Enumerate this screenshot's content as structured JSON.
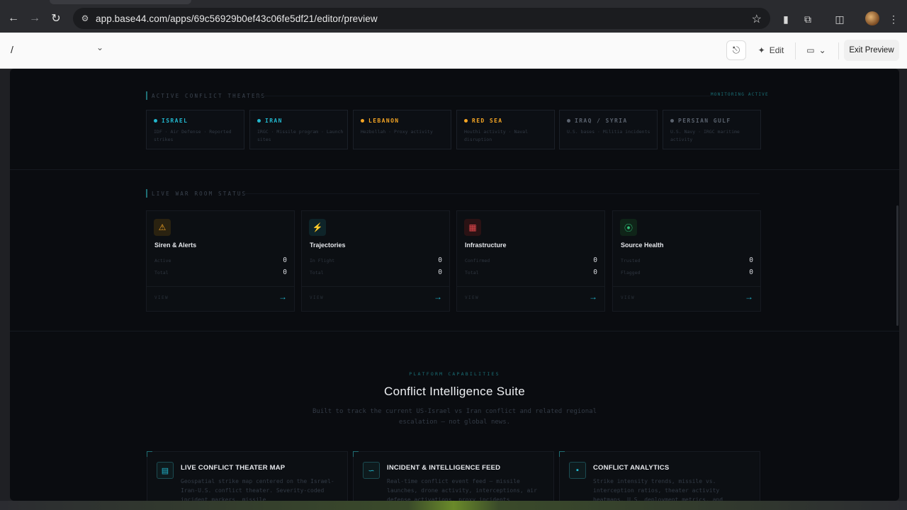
{
  "browser": {
    "url": "app.base44.com/apps/69c56929b0ef43c06fe5df21/editor/preview"
  },
  "editor": {
    "breadcrumb": "/",
    "edit_label": "Edit",
    "exit_label": "Exit Preview"
  },
  "theaters": {
    "label": "ACTIVE CONFLICT THEATERS",
    "status": "MONITORING ACTIVE",
    "items": [
      {
        "name": "ISRAEL",
        "desc": "IDF · Air Defense · Reported strikes",
        "color": "#22b8cf"
      },
      {
        "name": "IRAN",
        "desc": "IRGC · Missile program · Launch sites",
        "color": "#22b8cf"
      },
      {
        "name": "LEBANON",
        "desc": "Hezbollah · Proxy activity",
        "color": "#f5a524"
      },
      {
        "name": "RED SEA",
        "desc": "Houthi activity · Naval disruption",
        "color": "#f5a524"
      },
      {
        "name": "IRAQ / SYRIA",
        "desc": "U.S. bases · Militia incidents",
        "color": "#5a626e"
      },
      {
        "name": "PERSIAN GULF",
        "desc": "U.S. Navy · IRGC maritime activity",
        "color": "#5a626e"
      }
    ]
  },
  "war_room": {
    "label": "LIVE WAR ROOM STATUS",
    "cards": [
      {
        "title": "Siren & Alerts",
        "row1_label": "Active",
        "row1_value": "0",
        "row2_label": "Total",
        "row2_value": "0",
        "view": "VIEW"
      },
      {
        "title": "Trajectories",
        "row1_label": "In Flight",
        "row1_value": "0",
        "row2_label": "Total",
        "row2_value": "0",
        "view": "VIEW"
      },
      {
        "title": "Infrastructure",
        "row1_label": "Confirmed",
        "row1_value": "0",
        "row2_label": "Total",
        "row2_value": "0",
        "view": "VIEW"
      },
      {
        "title": "Source Health",
        "row1_label": "Trusted",
        "row1_value": "0",
        "row2_label": "Flagged",
        "row2_value": "0",
        "view": "VIEW"
      }
    ]
  },
  "capabilities": {
    "eyebrow": "PLATFORM CAPABILITIES",
    "title": "Conflict Intelligence Suite",
    "subtitle": "Built to track the current US-Israel vs Iran conflict and related regional escalation — not global news.",
    "features": [
      {
        "title": "LIVE CONFLICT THEATER MAP",
        "desc": "Geospatial strike map centered on the Israel-Iran-U.S. conflict theater. Severity-coded incident markers, missile"
      },
      {
        "title": "INCIDENT & INTELLIGENCE FEED",
        "desc": "Real-time conflict event feed — missile launches, drone activity, interceptions, air defense activations, proxy incidents"
      },
      {
        "title": "CONFLICT ANALYTICS",
        "desc": "Strike intensity trends, missile vs. interception ratios, theater activity heatmaps, U.S. deployment metrics, and"
      }
    ]
  }
}
